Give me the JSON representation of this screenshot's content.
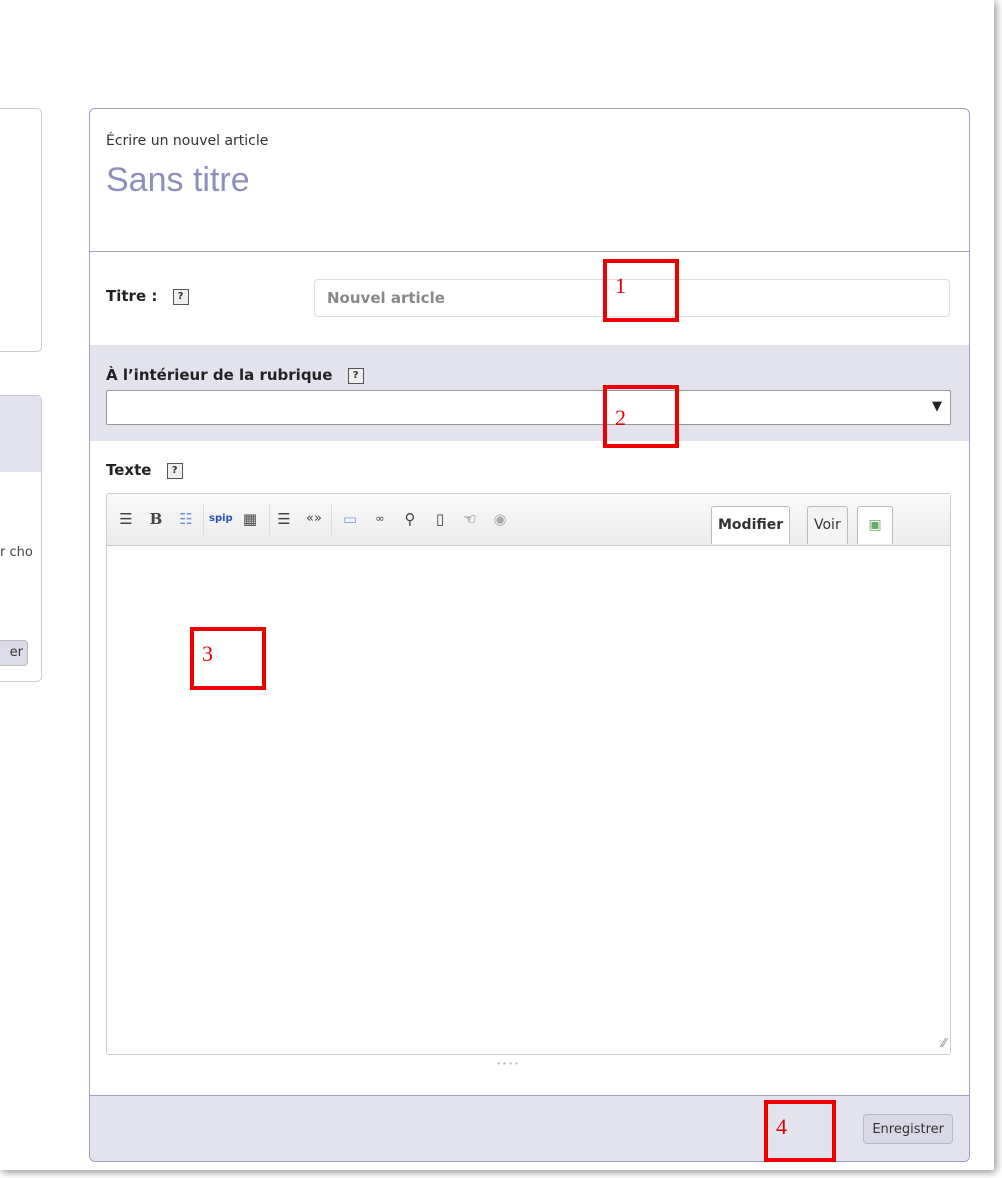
{
  "left_panel": {
    "cut_text": "r cho",
    "cut_button": "er"
  },
  "header": {
    "subtitle": "Écrire un nouvel article",
    "title": "Sans titre"
  },
  "form": {
    "titre_label": "Titre :",
    "titre_placeholder": "Nouvel article",
    "rubrique_label": "À l’intérieur de la rubrique",
    "rubrique_value": "",
    "texte_label": "Texte",
    "help_glyph": "?"
  },
  "toolbar": {
    "buttons": [
      "align-center-icon",
      "bold-icon",
      "list-icon",
      "spip-icon",
      "table-icon",
      "indent-icon",
      "quote-icon",
      "image-icon",
      "glasses-icon",
      "person-icon",
      "document-icon",
      "hand-icon",
      "eye-icon"
    ],
    "tab_modifier": "Modifier",
    "tab_voir": "Voir"
  },
  "footer": {
    "save_label": "Enregistrer"
  },
  "markers": [
    "1",
    "2",
    "3",
    "4"
  ],
  "colors": {
    "accent": "#8f8fbb",
    "band": "#e3e3ee",
    "marker": "#e00000"
  }
}
